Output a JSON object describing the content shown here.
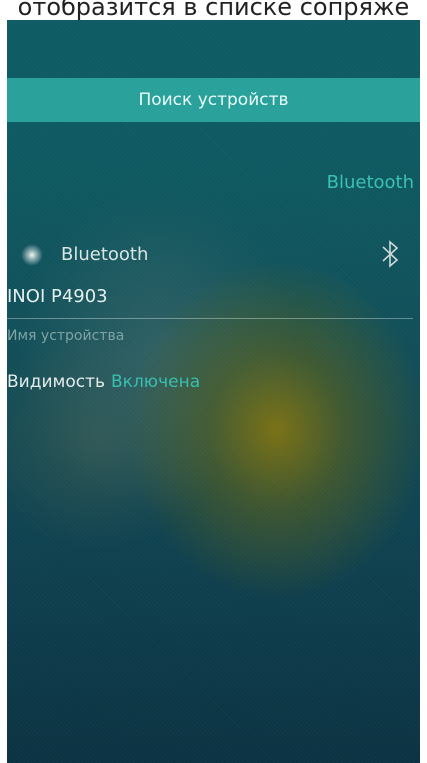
{
  "top_caption": "отобразится в списке сопряже",
  "search_button_label": "Поиск устройств",
  "section_title": "Bluetooth",
  "bluetooth_row": {
    "label": "Bluetooth",
    "toggle_icon": "bluetooth-icon"
  },
  "device": {
    "name": "INOI P4903",
    "caption": "Имя устройства"
  },
  "visibility": {
    "label": "Видимость",
    "value": "Включена"
  },
  "colors": {
    "accent": "#2aa29b",
    "accent_text": "#37bfb1"
  }
}
